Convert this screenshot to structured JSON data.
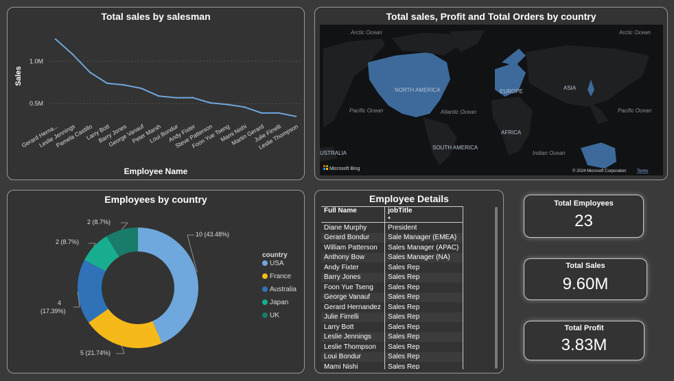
{
  "colors": {
    "accent": "#6fa8dc",
    "usa": "#6fa8dc",
    "france": "#f6b91a",
    "australia": "#2f72b8",
    "japan": "#19ad90",
    "uk": "#197b6a"
  },
  "line_card": {
    "title": "Total sales by salesman"
  },
  "map_card": {
    "title": "Total sales, Profit and Total Orders by country",
    "labels": [
      "Arctic Ocean",
      "Arctic Ocean",
      "Pacific Ocean",
      "Atlantic Ocean",
      "Pacific Ocean",
      "NORTH AMERICA",
      "EUROPE",
      "ASIA",
      "AFRICA",
      "SOUTH AMERICA",
      "Indian Ocean",
      "USTRALIA"
    ],
    "bing": "Microsoft Bing",
    "copyright": "© 2024 Microsoft Corporation",
    "terms": "Terms"
  },
  "donut_card": {
    "title": "Employees by country",
    "legend_title": "country"
  },
  "details_card": {
    "title": "Employee Details",
    "columns": [
      "Full Name",
      "jobTitle"
    ],
    "rows": [
      [
        "Diane Murphy",
        "President"
      ],
      [
        "Gerard Bondur",
        "Sale Manager (EMEA)"
      ],
      [
        "William Patterson",
        "Sales Manager (APAC)"
      ],
      [
        "Anthony Bow",
        "Sales Manager (NA)"
      ],
      [
        "Andy Fixter",
        "Sales Rep"
      ],
      [
        "Barry Jones",
        "Sales Rep"
      ],
      [
        "Foon Yue Tseng",
        "Sales Rep"
      ],
      [
        "George Vanauf",
        "Sales Rep"
      ],
      [
        "Gerard Hernandez",
        "Sales Rep"
      ],
      [
        "Julie Firrelli",
        "Sales Rep"
      ],
      [
        "Larry Bott",
        "Sales Rep"
      ],
      [
        "Leslie Jennings",
        "Sales Rep"
      ],
      [
        "Leslie Thompson",
        "Sales Rep"
      ],
      [
        "Loui Bondur",
        "Sales Rep"
      ],
      [
        "Mami Nishi",
        "Sales Rep"
      ]
    ]
  },
  "kpis": {
    "employees": {
      "label": "Total Employees",
      "value": "23"
    },
    "sales": {
      "label": "Total Sales",
      "value": "9.60M"
    },
    "profit": {
      "label": "Total Profit",
      "value": "3.83M"
    }
  },
  "chart_data": [
    {
      "type": "line",
      "title": "Total sales by salesman",
      "xlabel": "Employee Name",
      "ylabel": "Sales",
      "categories": [
        "Gerard Hernandez",
        "Leslie Jennings",
        "Pamela Castillo",
        "Larry Bott",
        "Barry Jones",
        "George Vanauf",
        "Peter Marsh",
        "Loui Bondur",
        "Andy Fixter",
        "Steve Patterson",
        "Foon Yue Tseng",
        "Mami Nishi",
        "Martin Gerard",
        "Julie Firrelli",
        "Leslie Thompson"
      ],
      "tick_labels": [
        "Gerard Herna...",
        "Leslie Jennings",
        "Pamela Castillo",
        "Larry Bott",
        "Barry Jones",
        "George Vanauf",
        "Peter Marsh",
        "Loui Bondur",
        "Andy Fixter",
        "Steve Patterson",
        "Foon Yue Tseng",
        "Mami Nishi",
        "Martin Gerard",
        "Julie Firrelli",
        "Leslie Thompson"
      ],
      "values": [
        1.26,
        1.08,
        0.87,
        0.74,
        0.72,
        0.68,
        0.59,
        0.57,
        0.57,
        0.51,
        0.49,
        0.46,
        0.39,
        0.39,
        0.35
      ],
      "yticks": [
        {
          "v": 0.5,
          "label": "0.5M"
        },
        {
          "v": 1.0,
          "label": "1.0M"
        }
      ],
      "ylim": [
        0.3,
        1.35
      ],
      "grid": true
    },
    {
      "type": "pie",
      "title": "Employees by country",
      "legend_position": "right",
      "slices": [
        {
          "name": "USA",
          "value": 10,
          "label": "10 (43.48%)"
        },
        {
          "name": "France",
          "value": 5,
          "label": "5 (21.74%)"
        },
        {
          "name": "Australia",
          "value": 4,
          "label_line1": "4",
          "label_line2": "(17.39%)"
        },
        {
          "name": "Japan",
          "value": 2,
          "label": "2 (8.7%)"
        },
        {
          "name": "UK",
          "value": 2,
          "label": "2 (8.7%)"
        }
      ]
    }
  ]
}
